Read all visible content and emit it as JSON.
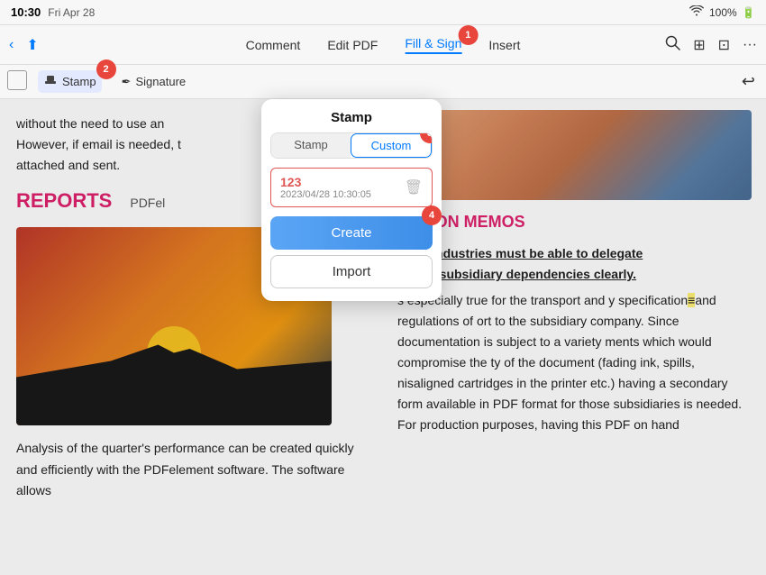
{
  "statusBar": {
    "time": "10:30",
    "day": "Fri Apr 28",
    "wifi": "wifi",
    "battery": "100%"
  },
  "toolbar": {
    "comment": "Comment",
    "editPdf": "Edit PDF",
    "fillSign": "Fill & Sign",
    "insert": "Insert",
    "back": "‹",
    "share": "⬆"
  },
  "subToolbar": {
    "stamp": "Stamp",
    "signature": "Signature"
  },
  "stampPopup": {
    "title": "Stamp",
    "tab1": "Stamp",
    "tab2": "Custom",
    "stampItem": {
      "number": "123",
      "date": "2023/04/28 10:30:05"
    },
    "createBtn": "Create",
    "importBtn": "Import"
  },
  "badges": {
    "b1": "1",
    "b2": "2",
    "b3": "3",
    "b4": "4"
  },
  "leftContent": {
    "intro": "without the need to use an However, if email is needed, t attached and sent.",
    "reportsTitle": "REPORTS",
    "pdfLabel": "PDFel",
    "bodyText": "Analysis of the quarter's performance can be created quickly and efficiently with the PDFelement software. The software allows"
  },
  "rightContent": {
    "gationTitle": "GATION MEMOS",
    "para1underline": "l Gas industries must be able to delegate o their subsidiary dependencies clearly.",
    "para2": "s especially true for the transport and y specification",
    "para2cont": "and regulations of ort to the subsidiary company. Since documentation is subject to a variety ments which would compromise the ty of the document (fading ink, spills, nisaligned cartridges in the printer etc.) having a secondary form available in PDF format for those subsidiaries is needed. For production purposes, having this PDF on hand"
  }
}
